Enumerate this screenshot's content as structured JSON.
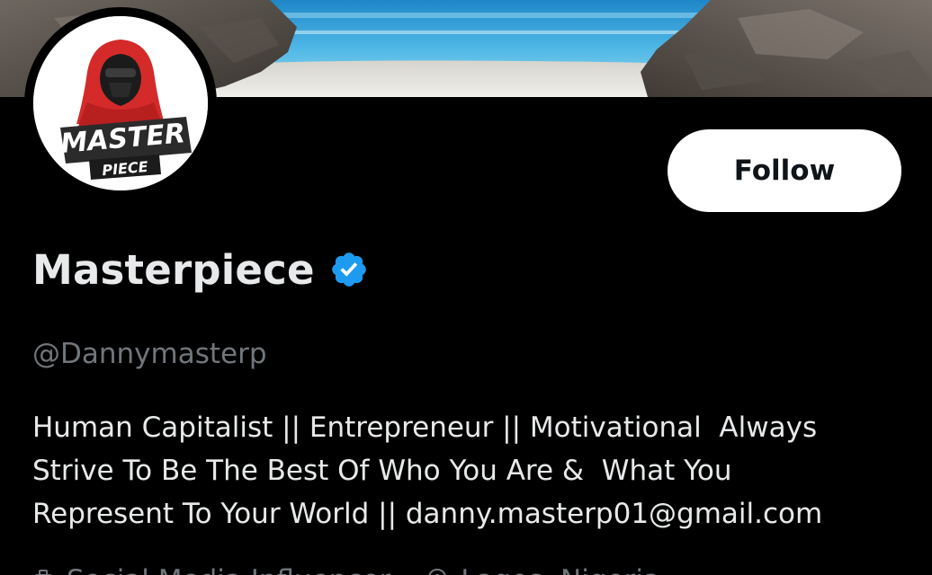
{
  "profile": {
    "display_name": "Masterpiece",
    "handle": "@Dannymasterp",
    "verified": true,
    "bio_lines": [
      "Human Capitalist || Entrepreneur || Motivational  Always",
      "Strive To Be The Best Of Who You Are &  What You",
      "Represent To Your World || danny.masterp01@gmail.com"
    ],
    "category": "Social Media Influencer",
    "location": "Lagos, Nigeria"
  },
  "avatar": {
    "logo_line1": "MASTER",
    "logo_line2": "PIECE"
  },
  "actions": {
    "follow_label": "Follow"
  },
  "colors": {
    "background": "#000000",
    "primary_text": "#e7e9ea",
    "secondary_text": "#71767b",
    "verified_blue": "#1d9bf0",
    "button_bg": "#ffffff"
  },
  "icons": {
    "verified": "verified-badge-icon",
    "category": "briefcase-icon",
    "location": "location-pin-icon"
  }
}
